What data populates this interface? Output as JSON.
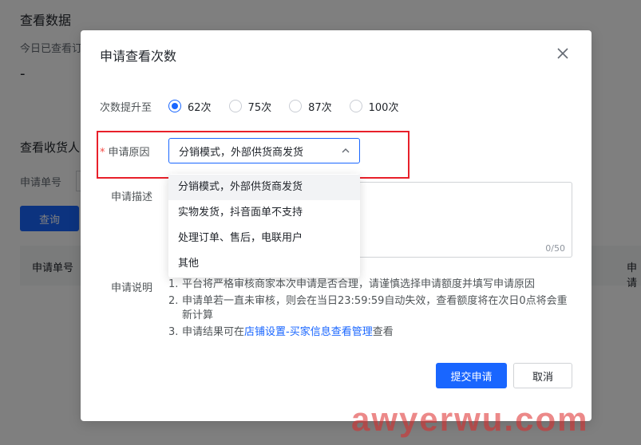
{
  "background": {
    "section_title": "查看数据",
    "today_viewed_label": "今日已查看订",
    "today_viewed_value": "-",
    "receiver_section_title": "查看收货人",
    "apply_no_label": "申请单号",
    "query_button": "查询",
    "table_header_apply_no": "申请单号",
    "table_header_right": "申请"
  },
  "modal": {
    "title": "申请查看次数",
    "times_label": "次数提升至",
    "times_options": [
      "62次",
      "75次",
      "87次",
      "100次"
    ],
    "times_selected": "62次",
    "reason_label": "申请原因",
    "reason_selected": "分销模式，外部供货商发货",
    "reason_options": [
      "分销模式，外部供货商发货",
      "实物发货，抖音面单不支持",
      "处理订单、售后，电联用户",
      "其他"
    ],
    "desc_label": "申请描述",
    "desc_counter": "0/50",
    "notes_label": "申请说明",
    "notes": {
      "n1_num": "1.",
      "n1_text": "平台将严格审核商家本次申请是否合理，请谨慎选择申请额度并填写申请原因",
      "n2_num": "2.",
      "n2_text": "申请单若一直未审核，则会在当日23:59:59自动失效，查看额度将在次日0点将会重新计算",
      "n3_num": "3.",
      "n3_pre": "申请结果可在",
      "n3_link": "店铺设置-买家信息查看管理",
      "n3_post": "查看"
    },
    "submit_button": "提交申请",
    "cancel_button": "取消"
  },
  "watermark": "awyerwu.com",
  "colors": {
    "primary": "#1966ff",
    "required": "#f54a45",
    "highlight_box": "#e8202a"
  }
}
